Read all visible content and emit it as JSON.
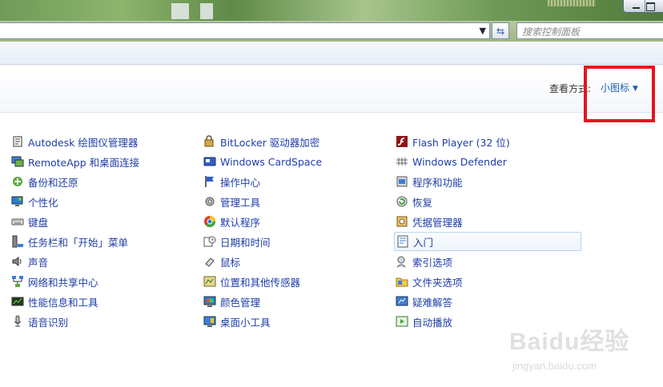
{
  "address_bar": {
    "search_placeholder": "搜索控制面板"
  },
  "header": {
    "view_by_label": "查看方式:",
    "view_by_value": "小图标"
  },
  "items": [
    {
      "label": "Autodesk 绘图仪管理器",
      "icon": "plotter-icon"
    },
    {
      "label": "RemoteApp 和桌面连接",
      "icon": "remote-desktop-icon"
    },
    {
      "label": "备份和还原",
      "icon": "backup-icon"
    },
    {
      "label": "个性化",
      "icon": "personalization-icon"
    },
    {
      "label": "键盘",
      "icon": "keyboard-icon"
    },
    {
      "label": "任务栏和「开始」菜单",
      "icon": "taskbar-icon"
    },
    {
      "label": "声音",
      "icon": "speaker-icon"
    },
    {
      "label": "网络和共享中心",
      "icon": "network-icon"
    },
    {
      "label": "性能信息和工具",
      "icon": "performance-icon"
    },
    {
      "label": "语音识别",
      "icon": "microphone-icon"
    },
    {
      "label": "BitLocker 驱动器加密",
      "icon": "bitlocker-icon"
    },
    {
      "label": "Windows CardSpace",
      "icon": "cardspace-icon"
    },
    {
      "label": "操作中心",
      "icon": "flag-icon"
    },
    {
      "label": "管理工具",
      "icon": "admin-tools-icon"
    },
    {
      "label": "默认程序",
      "icon": "default-programs-icon"
    },
    {
      "label": "日期和时间",
      "icon": "clock-icon"
    },
    {
      "label": "鼠标",
      "icon": "mouse-icon"
    },
    {
      "label": "位置和其他传感器",
      "icon": "sensor-icon"
    },
    {
      "label": "颜色管理",
      "icon": "color-management-icon"
    },
    {
      "label": "桌面小工具",
      "icon": "gadgets-icon"
    },
    {
      "label": "Flash Player (32 位)",
      "icon": "flash-icon"
    },
    {
      "label": "Windows Defender",
      "icon": "defender-icon"
    },
    {
      "label": "程序和功能",
      "icon": "programs-icon"
    },
    {
      "label": "恢复",
      "icon": "recovery-icon"
    },
    {
      "label": "凭据管理器",
      "icon": "credential-icon"
    },
    {
      "label": "入门",
      "icon": "getting-started-icon"
    },
    {
      "label": "索引选项",
      "icon": "indexing-icon"
    },
    {
      "label": "文件夹选项",
      "icon": "folder-icon"
    },
    {
      "label": "疑难解答",
      "icon": "troubleshoot-icon"
    },
    {
      "label": "自动播放",
      "icon": "autoplay-icon"
    }
  ],
  "colors": {
    "link": "#1f3ea8",
    "highlight": "#e4151f",
    "view_by": "#1e5fb0"
  },
  "watermark": {
    "brand": "Baidu经验",
    "url": "jingyan.baidu.com"
  }
}
